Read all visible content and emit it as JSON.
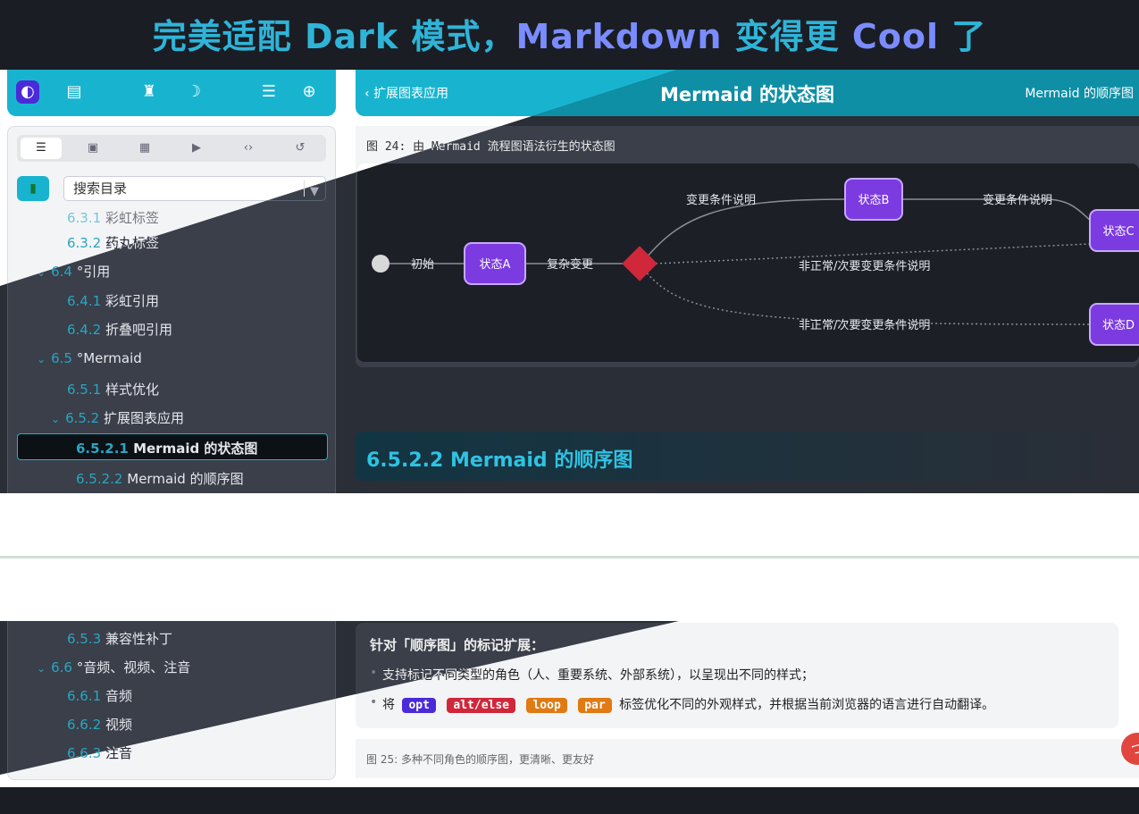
{
  "banner": {
    "prefix": "完美适配 ",
    "dark": "Dark",
    "middle": " 模式，",
    "markdown": "Markdown",
    "rest": " 变得更 ",
    "cool": "Cool",
    "end": " 了"
  },
  "colors": {
    "accent": "#18b4cf",
    "state": "#7b3be0",
    "choice": "#d0273a"
  },
  "toolbar": {
    "icons": [
      "compass-icon",
      "printer-icon",
      "shirt-icon",
      "moon-icon",
      "outline-icon",
      "locate-icon"
    ]
  },
  "nav": {
    "back": "扩展图表应用",
    "title": "Mermaid 的状态图",
    "next": "Mermaid 的顺序图"
  },
  "side_tabs": {
    "icons": [
      "list-icon",
      "image-icon",
      "table-icon",
      "video-icon",
      "code-icon",
      "history-icon"
    ]
  },
  "search": {
    "placeholder": "搜索目录"
  },
  "toc_top": [
    {
      "num": "6.3.1",
      "label": "彩虹标签"
    },
    {
      "num": "6.3.2",
      "label": "药丸标签"
    },
    {
      "num": "6.4",
      "label": "°引用"
    },
    {
      "num": "6.4.1",
      "label": "彩虹引用"
    },
    {
      "num": "6.4.2",
      "label": "折叠吧引用"
    },
    {
      "num": "6.5",
      "label": "°Mermaid"
    },
    {
      "num": "6.5.1",
      "label": "样式优化"
    },
    {
      "num": "6.5.2",
      "label": "扩展图表应用"
    },
    {
      "num": "6.5.2.1",
      "label": "Mermaid 的状态图"
    },
    {
      "num": "6.5.2.2",
      "label": "Mermaid 的顺序图"
    }
  ],
  "figure24": {
    "caption": "图 24: 由 Mermaid 流程图语法衍生的状态图",
    "states": {
      "a": "状态A",
      "b": "状态B",
      "c": "状态C",
      "d": "状态D"
    },
    "edges": {
      "start": "初始",
      "complex": "复杂变更",
      "cond1": "变更条件说明",
      "cond2": "变更条件说明",
      "abn1": "非正常/次要变更条件说明",
      "abn2": "非正常/次要变更条件说明"
    }
  },
  "section_heading": "6.5.2.2 Mermaid 的顺序图",
  "toc_bottom": [
    {
      "num": "6.5.3",
      "label": "兼容性补丁"
    },
    {
      "num": "6.6",
      "label": "°音频、视频、注音"
    },
    {
      "num": "6.6.1",
      "label": "音频"
    },
    {
      "num": "6.6.2",
      "label": "视频"
    },
    {
      "num": "6.6.3",
      "label": "注音"
    }
  ],
  "note": {
    "title": "针对「顺序图」的标记扩展：",
    "bullet1": "支持标记不同类型的角色（人、重要系统、外部系统），以呈现出不同的样式；",
    "bullet2_pre": "将",
    "tags": [
      "opt",
      "alt/else",
      "loop",
      "par"
    ],
    "bullet2_post": "标签优化不同的外观样式，并根据当前浏览器的语言进行自动翻译。"
  },
  "figure25": {
    "caption": "图 25: 多种不同角色的顺序图，更清晰、更友好"
  },
  "fab": {
    "label": "つ"
  }
}
